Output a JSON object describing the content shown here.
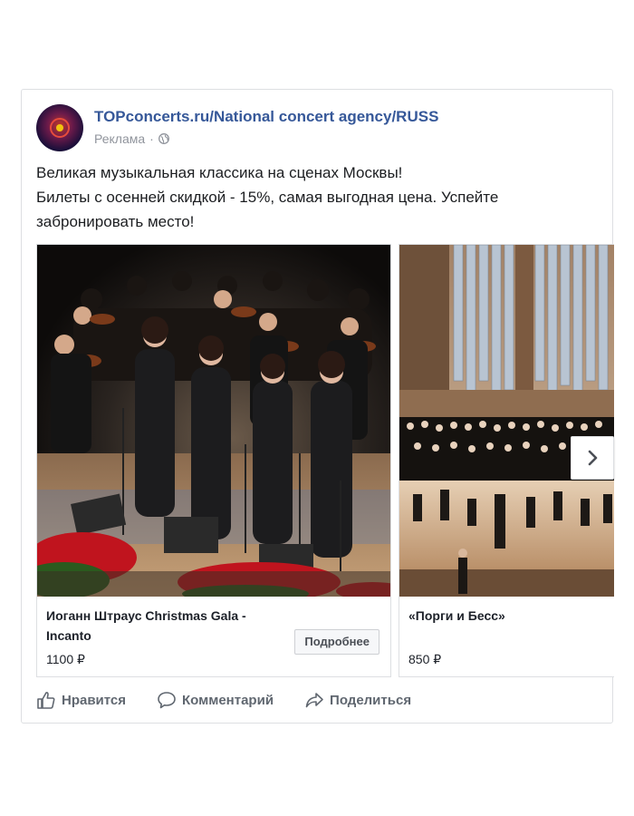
{
  "post": {
    "page_name": "TOPconcerts.ru/National concert agency/RUSS",
    "sponsored_label": "Реклама",
    "separator": "·",
    "text_lines": [
      "Великая музыкальная классика на сценах Москвы!",
      "Билеты с осенней скидкой - 15%, самая выгодная цена. Успейте",
      "забронировать место!"
    ]
  },
  "cards": [
    {
      "title_line1": "Иоганн Штраус Christmas Gala -",
      "title_line2": "Incanto",
      "price": "1100 ₽",
      "button_label": "Подробнее"
    },
    {
      "title_line1": "«Порги и Бесс»",
      "price": "850 ₽"
    }
  ],
  "actions": {
    "like": "Нравится",
    "comment": "Комментарий",
    "share": "Поделиться"
  },
  "icons": [
    "page-avatar-logo",
    "globe-icon",
    "chevron-right-icon",
    "like-icon",
    "comment-icon",
    "share-icon"
  ],
  "colors": {
    "link": "#365899",
    "muted": "#90949c",
    "action": "#606770"
  }
}
